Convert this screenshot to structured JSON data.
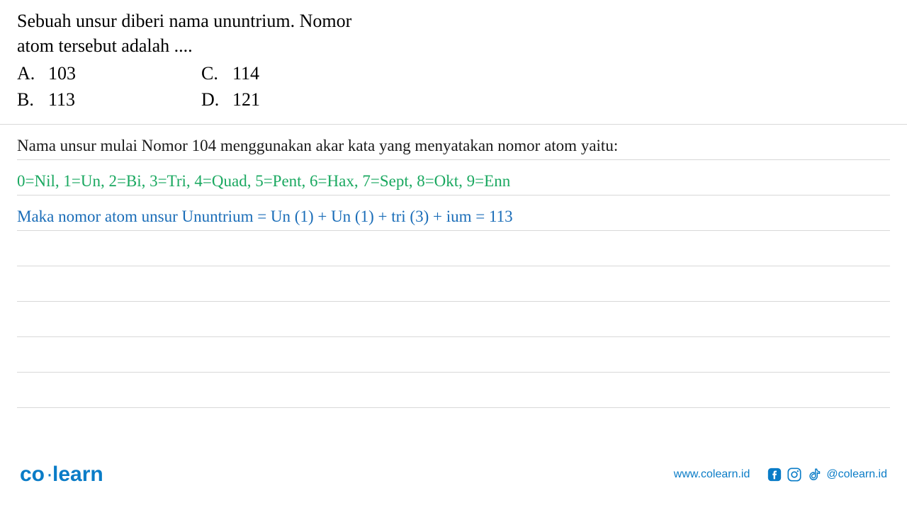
{
  "question": {
    "line1": "Sebuah unsur diberi nama ununtrium. Nomor",
    "line2": "atom tersebut adalah ....",
    "options": {
      "A": {
        "letter": "A.",
        "value": "103"
      },
      "B": {
        "letter": "B.",
        "value": "113"
      },
      "C": {
        "letter": "C.",
        "value": "114"
      },
      "D": {
        "letter": "D.",
        "value": "121"
      }
    }
  },
  "answer": {
    "line1": "Nama unsur mulai Nomor 104 menggunakan akar kata yang menyatakan nomor atom yaitu:",
    "line2": "0=Nil, 1=Un, 2=Bi, 3=Tri, 4=Quad, 5=Pent, 6=Hax, 7=Sept, 8=Okt, 9=Enn",
    "line3": "Maka nomor atom unsur Ununtrium = Un (1) + Un (1) + tri (3) + ium = 113"
  },
  "footer": {
    "logo_co": "co",
    "logo_learn": "learn",
    "website": "www.colearn.id",
    "handle": "@colearn.id"
  }
}
